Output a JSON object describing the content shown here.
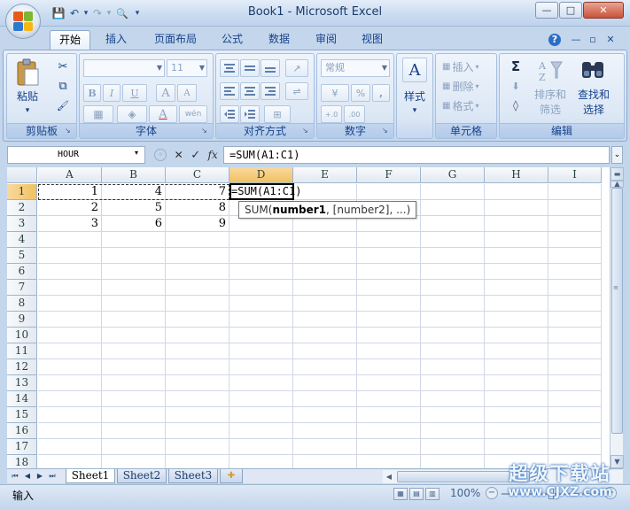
{
  "window": {
    "title": "Book1 - Microsoft Excel",
    "quick_access": {
      "save": "💾",
      "undo": "↶",
      "redo": "↷",
      "preview": "🔍",
      "dropdown": "▾"
    },
    "controls": {
      "minimize": "—",
      "maximize": "□",
      "close": "✕"
    }
  },
  "tabs": {
    "items": [
      "开始",
      "插入",
      "页面布局",
      "公式",
      "数据",
      "审阅",
      "视图"
    ],
    "active": "开始",
    "help": "?",
    "ribbon_min": "—",
    "ribbon_restore": "▫",
    "ribbon_close": "✕"
  },
  "ribbon": {
    "clipboard": {
      "label": "剪贴板",
      "paste": "粘贴",
      "paste_arrow": "▾",
      "cut": "✂",
      "copy": "⧉",
      "format_painter": "🖌"
    },
    "font": {
      "label": "字体",
      "font_name": "",
      "font_size": "11",
      "bold": "B",
      "italic": "I",
      "underline": "U",
      "grow": "A",
      "shrink": "A",
      "border": "▦",
      "fill": "◈",
      "color": "A",
      "phonetic": "wén"
    },
    "alignment": {
      "label": "对齐方式",
      "wrap": "⇌",
      "merge": "⊞",
      "orient": "↗"
    },
    "number": {
      "label": "数字",
      "format": "常规",
      "currency": "¥",
      "percent": "%",
      "comma": ",",
      "inc": "+.0",
      "dec": ".00"
    },
    "styles": {
      "label": "样式",
      "icon": "A",
      "arrow": "▾"
    },
    "cells": {
      "label": "单元格",
      "insert": "插入",
      "delete": "删除",
      "format": "格式"
    },
    "editing": {
      "label": "编辑",
      "sum": "Σ",
      "fill": "⬇",
      "clear": "◊",
      "sort_label_1": "排序和",
      "sort_label_2": "筛选",
      "find_label_1": "查找和",
      "find_label_2": "选择",
      "arrow": "▾"
    }
  },
  "formula_bar": {
    "name_box": "HOUR",
    "name_box_arrow": "▾",
    "cancel": "✕",
    "enter": "✓",
    "fx": "fx",
    "formula": "=SUM(A1:C1)",
    "expand": "⌄"
  },
  "grid": {
    "columns": [
      "A",
      "B",
      "C",
      "D",
      "E",
      "F",
      "G",
      "H",
      "I"
    ],
    "rows": [
      "1",
      "2",
      "3",
      "4",
      "5",
      "6",
      "7",
      "8",
      "9",
      "10",
      "11",
      "12",
      "13",
      "14",
      "15",
      "16",
      "17",
      "18"
    ],
    "cells": [
      {
        "ref": "A1",
        "value": "1"
      },
      {
        "ref": "B1",
        "value": "4"
      },
      {
        "ref": "C1",
        "value": "7"
      },
      {
        "ref": "D1",
        "value": "=SUM(A1:C1)"
      },
      {
        "ref": "A2",
        "value": "2"
      },
      {
        "ref": "B2",
        "value": "5"
      },
      {
        "ref": "C2",
        "value": "8"
      },
      {
        "ref": "A3",
        "value": "3"
      },
      {
        "ref": "B3",
        "value": "6"
      },
      {
        "ref": "C3",
        "value": "9"
      }
    ],
    "active_cell": "D1",
    "tooltip_prefix": "SUM(",
    "tooltip_bold": "number1",
    "tooltip_rest": ", [number2], ...)"
  },
  "sheets": {
    "nav": [
      "⏮",
      "◀",
      "▶",
      "⏭"
    ],
    "tabs": [
      "Sheet1",
      "Sheet2",
      "Sheet3"
    ],
    "active": "Sheet1",
    "new_sheet": "✚"
  },
  "status": {
    "mode": "输入",
    "zoom": "100%",
    "zoom_minus": "−",
    "zoom_plus": "+",
    "views": [
      "▦",
      "▤",
      "▥"
    ]
  },
  "watermark": {
    "text_cn": "超级下载站",
    "url": "www.CJXZ.com"
  },
  "colors": {
    "accent": "#15428b",
    "selected_header": "#f1c15f",
    "gridline": "#d0d7e5"
  }
}
